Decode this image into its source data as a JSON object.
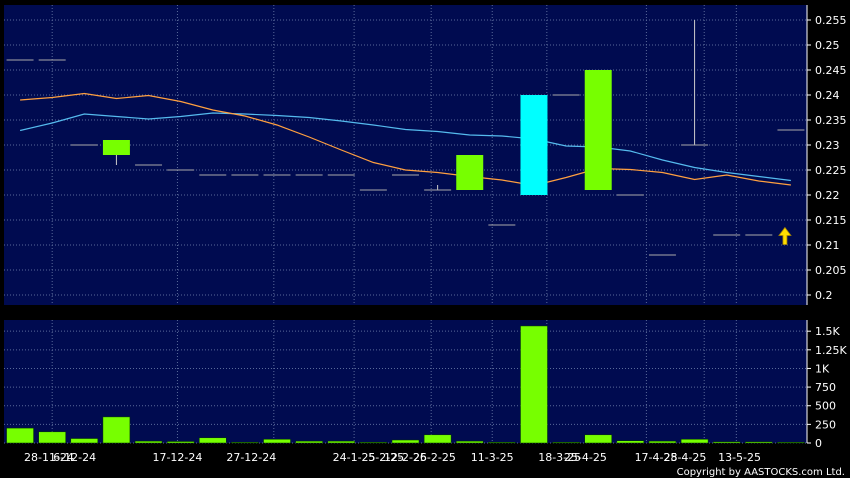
{
  "chart_data": [
    {
      "type": "candlestick",
      "title": "",
      "xlabel": "",
      "ylabel": "",
      "ylim": [
        0.198,
        0.258
      ],
      "yticks": [
        0.2,
        0.205,
        0.21,
        0.215,
        0.22,
        0.225,
        0.23,
        0.235,
        0.24,
        0.245,
        0.25,
        0.255
      ],
      "ytick_labels": [
        "0.2",
        "0.205",
        "0.21",
        "0.215",
        "0.22",
        "0.225",
        "0.23",
        "0.235",
        "0.24",
        "0.245",
        "0.25",
        "0.255"
      ],
      "grid": true,
      "background": "#000b50",
      "grid_color": "#5a6a9a",
      "colors": {
        "up": "#77ff00",
        "down": "#00ffff",
        "flat": "#aaaaaa",
        "ma_short": "#ffa040",
        "ma_long": "#55bbee",
        "arrow": "#ffdd00"
      },
      "candles": [
        {
          "o": 0.247,
          "h": 0.247,
          "l": 0.247,
          "c": 0.247
        },
        {
          "o": 0.247,
          "h": 0.247,
          "l": 0.247,
          "c": 0.247
        },
        {
          "o": 0.23,
          "h": 0.23,
          "l": 0.23,
          "c": 0.23
        },
        {
          "o": 0.228,
          "h": 0.231,
          "l": 0.226,
          "c": 0.231
        },
        {
          "o": 0.226,
          "h": 0.226,
          "l": 0.226,
          "c": 0.226
        },
        {
          "o": 0.225,
          "h": 0.225,
          "l": 0.225,
          "c": 0.225
        },
        {
          "o": 0.224,
          "h": 0.224,
          "l": 0.224,
          "c": 0.224
        },
        {
          "o": 0.224,
          "h": 0.224,
          "l": 0.224,
          "c": 0.224
        },
        {
          "o": 0.224,
          "h": 0.224,
          "l": 0.224,
          "c": 0.224
        },
        {
          "o": 0.224,
          "h": 0.224,
          "l": 0.224,
          "c": 0.224
        },
        {
          "o": 0.224,
          "h": 0.224,
          "l": 0.224,
          "c": 0.224
        },
        {
          "o": 0.221,
          "h": 0.221,
          "l": 0.221,
          "c": 0.221
        },
        {
          "o": 0.224,
          "h": 0.224,
          "l": 0.224,
          "c": 0.224
        },
        {
          "o": 0.221,
          "h": 0.222,
          "l": 0.221,
          "c": 0.221
        },
        {
          "o": 0.221,
          "h": 0.228,
          "l": 0.221,
          "c": 0.228
        },
        {
          "o": 0.214,
          "h": 0.214,
          "l": 0.214,
          "c": 0.214
        },
        {
          "o": 0.24,
          "h": 0.24,
          "l": 0.22,
          "c": 0.22
        },
        {
          "o": 0.24,
          "h": 0.24,
          "l": 0.24,
          "c": 0.24
        },
        {
          "o": 0.221,
          "h": 0.245,
          "l": 0.221,
          "c": 0.245
        },
        {
          "o": 0.22,
          "h": 0.22,
          "l": 0.22,
          "c": 0.22
        },
        {
          "o": 0.208,
          "h": 0.208,
          "l": 0.208,
          "c": 0.208
        },
        {
          "o": 0.23,
          "h": 0.255,
          "l": 0.23,
          "c": 0.23
        },
        {
          "o": 0.212,
          "h": 0.212,
          "l": 0.212,
          "c": 0.212
        },
        {
          "o": 0.212,
          "h": 0.212,
          "l": 0.212,
          "c": 0.212
        },
        {
          "o": 0.233,
          "h": 0.233,
          "l": 0.233,
          "c": 0.233
        }
      ],
      "ma_short": [
        0.239,
        0.2395,
        0.2403,
        0.2393,
        0.2399,
        0.2387,
        0.237,
        0.2358,
        0.234,
        0.2316,
        0.229,
        0.2265,
        0.225,
        0.2245,
        0.2237,
        0.223,
        0.2219,
        0.2235,
        0.2253,
        0.2251,
        0.2245,
        0.2231,
        0.224,
        0.2228,
        0.222
      ],
      "ma_long": [
        0.2329,
        0.2344,
        0.2362,
        0.2357,
        0.2352,
        0.2357,
        0.2364,
        0.2362,
        0.2359,
        0.2355,
        0.2348,
        0.234,
        0.2331,
        0.2327,
        0.232,
        0.2318,
        0.2312,
        0.2298,
        0.2296,
        0.2288,
        0.227,
        0.2255,
        0.2245,
        0.2237,
        0.2229
      ]
    },
    {
      "type": "bar",
      "title": "",
      "xlabel": "",
      "ylabel": "",
      "ylim": [
        0,
        1650
      ],
      "yticks": [
        0,
        250,
        500,
        750,
        1000,
        1250,
        1500
      ],
      "ytick_labels": [
        "0",
        "250",
        "500",
        "750",
        "1K",
        "1.25K",
        "1.5K"
      ],
      "grid": true,
      "background": "#000b50",
      "values": [
        200,
        150,
        60,
        350,
        25,
        20,
        70,
        10,
        50,
        25,
        25,
        10,
        40,
        110,
        25,
        10,
        1570,
        10,
        110,
        30,
        25,
        50,
        15,
        15,
        10
      ],
      "x_tick_labels": [
        {
          "index": 0.9,
          "label": "28-11-24"
        },
        {
          "index": 1.7,
          "label": "6-12-24"
        },
        {
          "index": 4.9,
          "label": "17-12-24"
        },
        {
          "index": 7.2,
          "label": "27-12-24"
        },
        {
          "index": 10.4,
          "label": "24-1-25"
        },
        {
          "index": 11.4,
          "label": "5-2-25"
        },
        {
          "index": 12.0,
          "label": "12-2-25"
        },
        {
          "index": 12.9,
          "label": "26-2-25"
        },
        {
          "index": 14.7,
          "label": "11-3-25"
        },
        {
          "index": 16.8,
          "label": "18-3-25"
        },
        {
          "index": 17.6,
          "label": "25-4-25"
        },
        {
          "index": 19.8,
          "label": "17-4-25"
        },
        {
          "index": 20.7,
          "label": "28-4-25"
        },
        {
          "index": 22.4,
          "label": "13-5-25"
        }
      ],
      "x_grid_index": [
        1.0,
        4.9,
        7.9,
        10.4,
        12.8,
        14.7,
        16.4,
        19.5,
        21.3,
        22.3
      ]
    }
  ],
  "copyright": "Copyright by AASTOCKS.com Ltd."
}
